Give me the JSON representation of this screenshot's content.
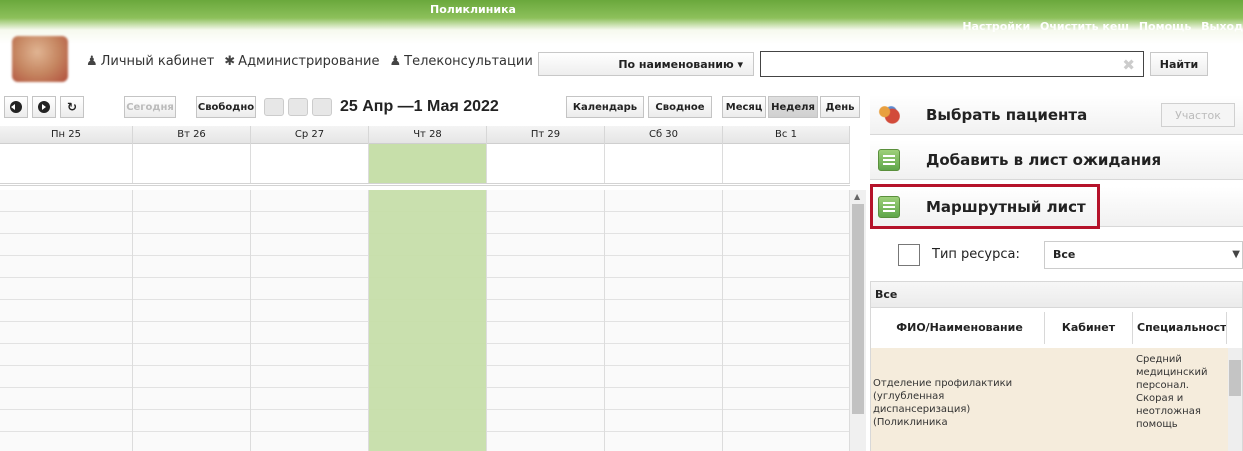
{
  "header": {
    "title": "Поликлиника",
    "top_links": [
      "Настройки",
      "Очистить кеш",
      "Помощь",
      "Выход"
    ],
    "nav": [
      {
        "icon": "user-icon",
        "label": "Личный кабинет"
      },
      {
        "icon": "tools-icon",
        "label": "Администрирование"
      },
      {
        "icon": "user-icon",
        "label": "Телеконсультации"
      }
    ],
    "search_mode": "По наименованию ▾",
    "search_value": "",
    "search_button": "Найти"
  },
  "toolbar": {
    "today_label": "Сегодня",
    "free_label": "Свободно",
    "date_range": "25 Апр —1 Мая 2022",
    "views": [
      "Календарь",
      "Сводное",
      "Месяц",
      "Неделя",
      "День"
    ],
    "active_view": "Неделя"
  },
  "calendar": {
    "days": [
      "Пн 25",
      "Вт 26",
      "Ср 27",
      "Чт 28",
      "Пт 29",
      "Сб 30",
      "Вс 1"
    ],
    "today_index": 3
  },
  "right_panel": {
    "select_patient": "Выбрать пациента",
    "uchastok": "Участок",
    "add_waitlist": "Добавить в лист ожидания",
    "route_sheet": "Маршрутный лист",
    "resource_type_label": "Тип ресурса:",
    "resource_type_value": "Все",
    "resources_title": "Все",
    "columns": [
      "ФИО/Наименование",
      "Кабинет",
      "Специальности"
    ],
    "row": {
      "fio": "Отделение профилактики (углубленная диспансеризация) (Поликлиника",
      "cabinet": "",
      "specialty": "Средний медицинский персонал. Скорая и неотложная помощь"
    }
  },
  "colors": {
    "header_green": "#6aa83c",
    "today_column": "#c7dfaa",
    "highlight_red": "#b5122a"
  }
}
